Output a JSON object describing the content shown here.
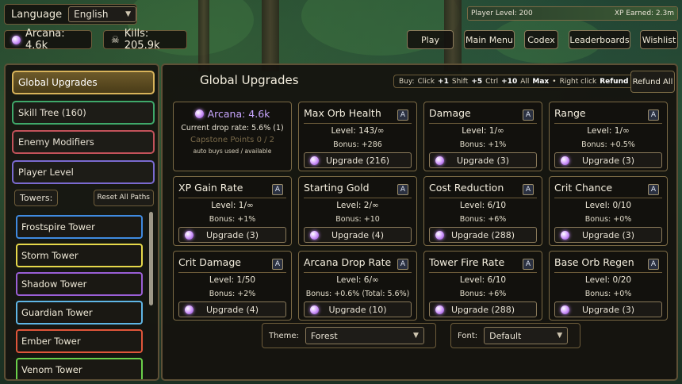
{
  "colors": {
    "gold_accent": "#d8b35a",
    "panel_border": "#5e5036",
    "arcana_purple": "#c8a6ff",
    "skill_tree": "#3fa86a",
    "enemy_modifiers": "#c2525a",
    "player_level": "#7a6ad0",
    "frostspire": "#3f8ae0",
    "storm": "#e6d84a",
    "shadow": "#9a5fd6",
    "guardian": "#5fb6e6",
    "ember": "#e0553a",
    "venom": "#6ad04a"
  },
  "language": {
    "label": "Language",
    "value": "English"
  },
  "stats": {
    "arcana": "Arcana: 4.6k",
    "kills": "Kills: 205.9k",
    "arcana_icon": "orb-icon",
    "kills_icon": "skull-icon"
  },
  "xp": {
    "player_level": "Player Level: 200",
    "xp_earned": "XP Earned: 2.3m"
  },
  "nav": {
    "play": "Play",
    "main_menu": "Main Menu",
    "codex": "Codex",
    "leaderboards": "Leaderboards",
    "wishlist": "Wishlist"
  },
  "sidebar": {
    "global_upgrades": "Global Upgrades",
    "skill_tree": "Skill Tree (160)",
    "enemy_modifiers": "Enemy Modifiers",
    "player_level": "Player Level",
    "towers_label": "Towers:",
    "reset_all_paths": "Reset All Paths",
    "towers": [
      "Frostspire Tower",
      "Storm Tower",
      "Shadow Tower",
      "Guardian Tower",
      "Ember Tower",
      "Venom Tower"
    ]
  },
  "main": {
    "title": "Global Upgrades",
    "hint": {
      "buy": "Buy:",
      "click": "Click",
      "click_val": "+1",
      "shift": "Shift",
      "shift_val": "+5",
      "ctrl": "Ctrl",
      "ctrl_val": "+10",
      "all": "All",
      "all_val": "Max",
      "sep": "•",
      "right_click": "Right click",
      "right_val": "Refund"
    },
    "refund_all": "Refund All",
    "info": {
      "arcana": "Arcana: 4.6k",
      "drop_rate": "Current drop rate: 5.6% (1)",
      "capstone": "Capstone Points 0 / 2",
      "auto_buys": "auto buys used / available"
    },
    "auto_btn": "A",
    "upgrades": [
      {
        "name": "Max Orb Health",
        "level": "Level: 143/∞",
        "bonus": "Bonus: +286",
        "button": "Upgrade (216)"
      },
      {
        "name": "Damage",
        "level": "Level: 1/∞",
        "bonus": "Bonus: +1%",
        "button": "Upgrade (3)"
      },
      {
        "name": "Range",
        "level": "Level: 1/∞",
        "bonus": "Bonus: +0.5%",
        "button": "Upgrade (3)"
      },
      {
        "name": "XP Gain Rate",
        "level": "Level: 1/∞",
        "bonus": "Bonus: +1%",
        "button": "Upgrade (3)"
      },
      {
        "name": "Starting Gold",
        "level": "Level: 2/∞",
        "bonus": "Bonus: +10",
        "button": "Upgrade (4)"
      },
      {
        "name": "Cost Reduction",
        "level": "Level: 6/10",
        "bonus": "Bonus: +6%",
        "button": "Upgrade (288)"
      },
      {
        "name": "Crit Chance",
        "level": "Level: 0/10",
        "bonus": "Bonus: +0%",
        "button": "Upgrade (3)"
      },
      {
        "name": "Crit Damage",
        "level": "Level: 1/50",
        "bonus": "Bonus: +2%",
        "button": "Upgrade (4)"
      },
      {
        "name": "Arcana Drop Rate",
        "level": "Level: 6/∞",
        "bonus": "Bonus: +0.6% (Total: 5.6%)",
        "button": "Upgrade (10)"
      },
      {
        "name": "Tower Fire Rate",
        "level": "Level: 6/10",
        "bonus": "Bonus: +6%",
        "button": "Upgrade (288)"
      },
      {
        "name": "Base Orb Regen",
        "level": "Level: 0/20",
        "bonus": "Bonus: +0%",
        "button": "Upgrade (3)"
      }
    ],
    "theme": {
      "label": "Theme:",
      "value": "Forest"
    },
    "font": {
      "label": "Font:",
      "value": "Default"
    }
  }
}
